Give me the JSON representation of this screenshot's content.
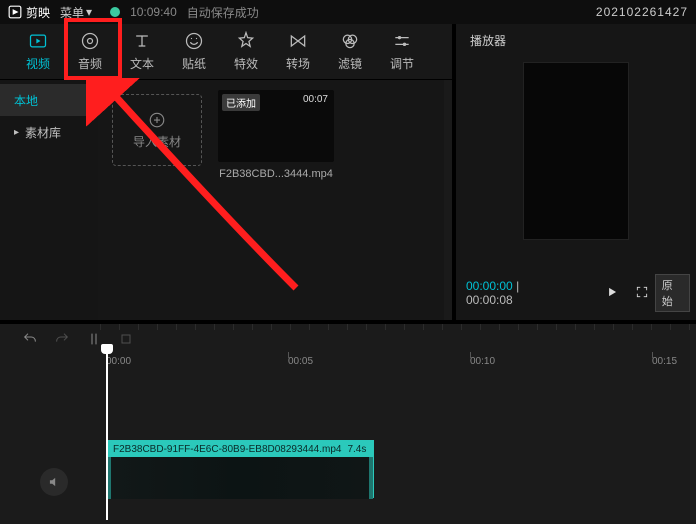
{
  "topbar": {
    "app_name": "剪映",
    "menu": "菜单",
    "autosave_time": "10:09:40",
    "autosave_text": "自动保存成功",
    "timestamp": "202102261427"
  },
  "tabs": [
    {
      "label": "视频",
      "icon": "video-icon"
    },
    {
      "label": "音频",
      "icon": "audio-icon"
    },
    {
      "label": "文本",
      "icon": "text-icon"
    },
    {
      "label": "贴纸",
      "icon": "sticker-icon"
    },
    {
      "label": "特效",
      "icon": "effect-icon"
    },
    {
      "label": "转场",
      "icon": "transition-icon"
    },
    {
      "label": "滤镜",
      "icon": "filter-icon"
    },
    {
      "label": "调节",
      "icon": "adjust-icon"
    }
  ],
  "sidebar": {
    "items": [
      {
        "label": "本地"
      },
      {
        "label": "素材库"
      }
    ]
  },
  "media": {
    "import_label": "导入素材",
    "clip": {
      "badge": "已添加",
      "duration": "00:07",
      "name": "F2B38CBD...3444.mp4"
    }
  },
  "player": {
    "title": "播放器",
    "current": "00:00:00",
    "total": "00:00:08",
    "ratio": "原始"
  },
  "timeline": {
    "ticks": [
      "00:00",
      "00:05",
      "00:10",
      "00:15"
    ],
    "clip_name": "F2B38CBD-91FF-4E6C-80B9-EB8D08293444.mp4",
    "clip_duration": "7.4s"
  }
}
